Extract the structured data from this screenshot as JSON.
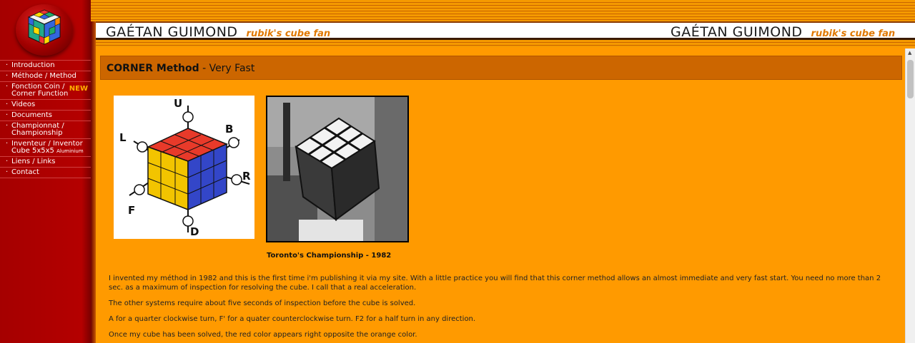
{
  "header": {
    "name": "GAÉTAN GUIMOND",
    "tagline": "rubik's cube fan"
  },
  "sidebar": {
    "items": [
      {
        "label": "Introduction"
      },
      {
        "label": "Méthode / Method"
      },
      {
        "label_line1": "Fonction Coin /",
        "label_line2": "Corner Function",
        "badge": "NEW"
      },
      {
        "label": "Videos"
      },
      {
        "label": "Documents"
      },
      {
        "label_line1": "Championnat /",
        "label_line2": "Championship"
      },
      {
        "label_line1": "Inventeur / Inventor",
        "label_line2": "Cube 5x5x5",
        "label_small": "Aluminium"
      },
      {
        "label": "Liens / Links"
      },
      {
        "label": "Contact"
      }
    ],
    "bullet": "·"
  },
  "main": {
    "title_bold": "CORNER Method",
    "title_rest": " - Very Fast",
    "notation_labels": {
      "u": "U",
      "b": "B",
      "l": "L",
      "r": "R",
      "f": "F",
      "d": "D"
    },
    "photo_caption": "Toronto's Championship - 1982",
    "paragraphs": [
      "I invented my méthod in 1982 and this is the first time i'm publishing it via my site. With a little practice you will find that this corner method allows an almost immediate and very fast start. You need no more than 2 sec. as a maximum of inspection for resolving the cube. I call that a real acceleration.",
      "The other systems require about five seconds of inspection before the cube is solved.",
      "A for a quarter clockwise turn, F' for a quater counterclockwise turn. F2 for a half turn in any direction.",
      "Once my cube has been solved, the red color appears right opposite the orange color."
    ]
  },
  "colors": {
    "page_bg": "#ff9a00",
    "sidebar_bg": "#b40000",
    "title_bar_bg": "#cc6600",
    "tagline": "#e07800",
    "new_badge": "#ffb000"
  },
  "icons": {
    "logo": "rubiks-cube-logo",
    "scroll_up": "scroll-up-arrow"
  }
}
